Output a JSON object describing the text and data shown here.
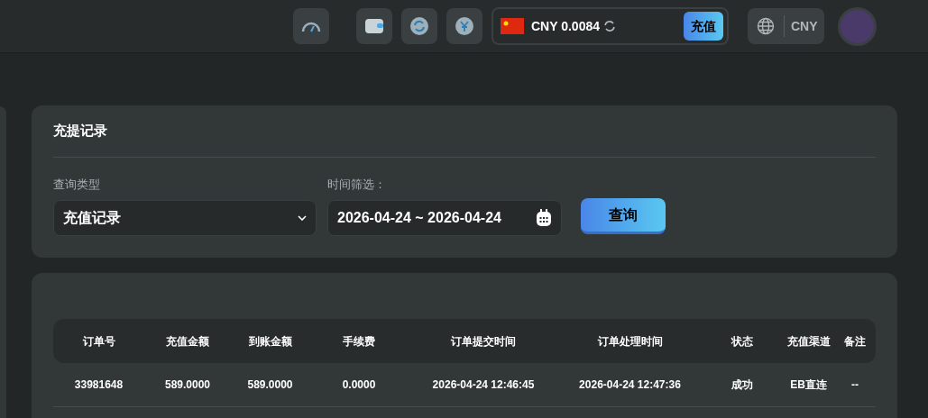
{
  "header": {
    "balance": {
      "currency": "CNY",
      "amount": "0.0084",
      "button": "充值"
    },
    "locale": {
      "currency": "CNY"
    }
  },
  "filter_card": {
    "title": "充提记录",
    "query_type": {
      "label": "查询类型",
      "value": "充值记录"
    },
    "date_filter": {
      "label": "时间筛选：",
      "value": "2026-04-24 ~ 2026-04-24"
    },
    "button": "查询"
  },
  "table": {
    "columns": [
      "订单号",
      "充值金额",
      "到账金额",
      "手续费",
      "订单提交时间",
      "订单处理时间",
      "状态",
      "充值渠道",
      "备注"
    ],
    "rows": [
      [
        "33981648",
        "589.0000",
        "589.0000",
        "0.0000",
        "2026-04-24 12:46:45",
        "2026-04-24 12:47:36",
        "成功",
        "EB直连",
        "--"
      ]
    ]
  }
}
